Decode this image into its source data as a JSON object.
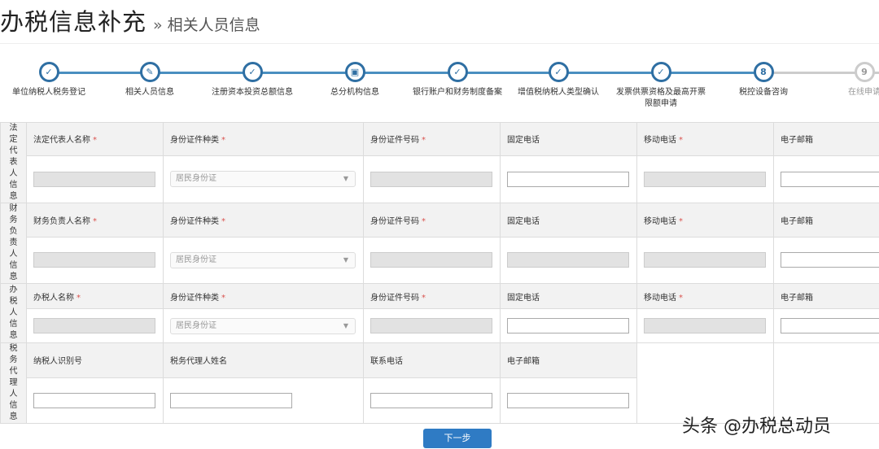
{
  "header": {
    "title": "办税信息补充",
    "separator": "»",
    "subtitle": "相关人员信息"
  },
  "steps": [
    {
      "label": "单位纳税人税务登记",
      "state": "done",
      "icon": "check-icon"
    },
    {
      "label": "相关人员信息",
      "state": "current",
      "icon": "edit-icon"
    },
    {
      "label": "注册资本投资总额信息",
      "state": "done",
      "icon": "check-icon"
    },
    {
      "label": "总分机构信息",
      "state": "done",
      "icon": "lock-icon"
    },
    {
      "label": "银行账户和财务制度备案",
      "state": "done",
      "icon": "check-icon"
    },
    {
      "label": "增值税纳税人类型确认",
      "state": "done",
      "icon": "check-icon"
    },
    {
      "label": "发票供票资格及最高开票限额申请",
      "state": "done",
      "icon": "check-icon"
    },
    {
      "label": "税控设备咨询",
      "state": "done",
      "number": "8"
    },
    {
      "label": "在线申请",
      "state": "todo",
      "number": "9"
    }
  ],
  "sections": {
    "legal": {
      "heading": "法定代表人信息",
      "labels": [
        "法定代表人名称",
        "身份证件种类",
        "身份证件号码",
        "固定电话",
        "移动电话",
        "电子邮箱"
      ],
      "id_type": "居民身份证"
    },
    "finance": {
      "heading": "财务负责人信息",
      "labels": [
        "财务负责人名称",
        "身份证件种类",
        "身份证件号码",
        "固定电话",
        "移动电话",
        "电子邮箱"
      ],
      "id_type": "居民身份证"
    },
    "tax": {
      "heading": "办税人信息",
      "labels": [
        "办税人名称",
        "身份证件种类",
        "身份证件号码",
        "固定电话",
        "移动电话",
        "电子邮箱"
      ],
      "id_type": "居民身份证"
    },
    "agent": {
      "heading": "税务代理人信息",
      "labels": [
        "纳税人识别号",
        "税务代理人姓名",
        "联系电话",
        "电子邮箱"
      ]
    }
  },
  "required_mark": "*",
  "next_button": "下一步",
  "watermark": "头条 @办税总动员"
}
